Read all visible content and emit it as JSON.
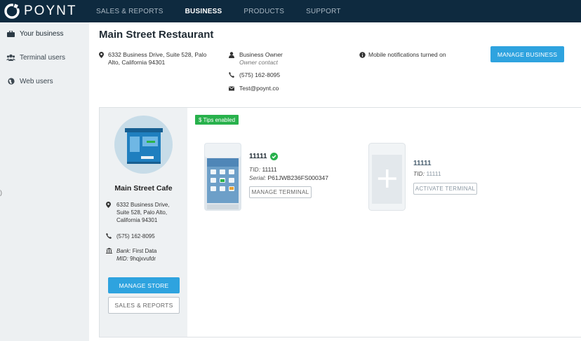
{
  "topbar": {
    "brand": "POYNT",
    "nav": [
      "SALES & REPORTS",
      "BUSINESS",
      "PRODUCTS",
      "SUPPORT"
    ],
    "active_nav": "BUSINESS"
  },
  "sidebar": {
    "items": [
      {
        "label": "Your business",
        "icon": "briefcase-icon"
      },
      {
        "label": "Terminal users",
        "icon": "users-icon"
      },
      {
        "label": "Web users",
        "icon": "globe-icon"
      }
    ]
  },
  "business": {
    "title": "Main Street Restaurant",
    "address_line1": "6332 Business Drive, Suite 528, Palo",
    "address_line2": "Alto, California 94301",
    "owner_name": "Business Owner",
    "owner_role": "Owner contact",
    "phone": "(575) 162-8095",
    "email": "Test@poynt.co",
    "notifications": "Mobile notifications turned on",
    "manage_button": "MANAGE BUSINESS"
  },
  "store": {
    "name": "Main Street Cafe",
    "address_line1": "6332 Business Drive,",
    "address_line2": "Suite 528, Palo Alto,",
    "address_line3": "California 94301",
    "phone": "(575) 162-8095",
    "bank_label": "Bank:",
    "bank_value": "First Data",
    "mid_label": "MID:",
    "mid_value": "9hqjxvufdr",
    "manage_button": "MANAGE STORE",
    "reports_button": "SALES & REPORTS",
    "tips_badge": "$ Tips enabled"
  },
  "terminals": [
    {
      "id": "11111",
      "tid_label": "TID:",
      "tid": "11111",
      "serial_label": "Serial:",
      "serial": "P61JWB236FS000347",
      "button": "MANAGE TERMINAL",
      "status": "active"
    },
    {
      "id": "11111",
      "tid_label": "TID:",
      "tid": "11111",
      "button": "ACTIVATE TERMINAL",
      "status": "inactive"
    }
  ],
  "colors": {
    "topbar": "#0e2a3f",
    "primary_button": "#2ea3df",
    "tips_badge": "#28b14c",
    "sidebar": "#edf0f2"
  }
}
